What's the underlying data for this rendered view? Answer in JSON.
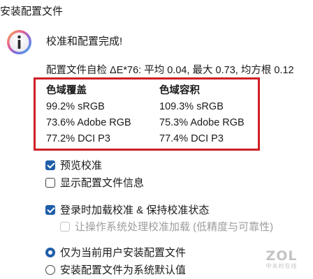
{
  "window": {
    "title": "安装配置文件"
  },
  "icon": {
    "name": "info-icon",
    "glyph": "i"
  },
  "heading": "校准和配置完成!",
  "self_check": "配置文件自检 ΔE*76: 平均 0.04, 最大 0.73, 均方根 0.12",
  "gamut": {
    "coverage": {
      "header": "色域覆盖",
      "rows": [
        "99.2% sRGB",
        "73.6% Adobe RGB",
        "77.2% DCI P3"
      ]
    },
    "volume": {
      "header": "色域容积",
      "rows": [
        "109.3% sRGB",
        "75.3% Adobe RGB",
        "77.4% DCI P3"
      ]
    },
    "highlight_color": "#cf1f25"
  },
  "options": {
    "preview_calibration": {
      "label": "预览校准",
      "checked": true
    },
    "show_profile_info": {
      "label": "显示配置文件信息",
      "checked": false
    },
    "load_on_login": {
      "label": "登录时加载校准 & 保持校准状态",
      "checked": true
    },
    "os_handle_calibration": {
      "label": "让操作系统处理校准加载 (低精度与可靠性)",
      "checked": false,
      "disabled": true
    }
  },
  "install_scope": {
    "current_user": {
      "label": "仅为当前用户安装配置文件",
      "selected": true
    },
    "system_default": {
      "label": "安装配置文件为系统默认值",
      "selected": false
    }
  },
  "watermark": {
    "brand": "ZOL",
    "sub": "中关村在线"
  },
  "colors": {
    "accent": "#1f5ea8",
    "text": "#1a1a1a",
    "disabled_text": "#9d9d9d"
  }
}
